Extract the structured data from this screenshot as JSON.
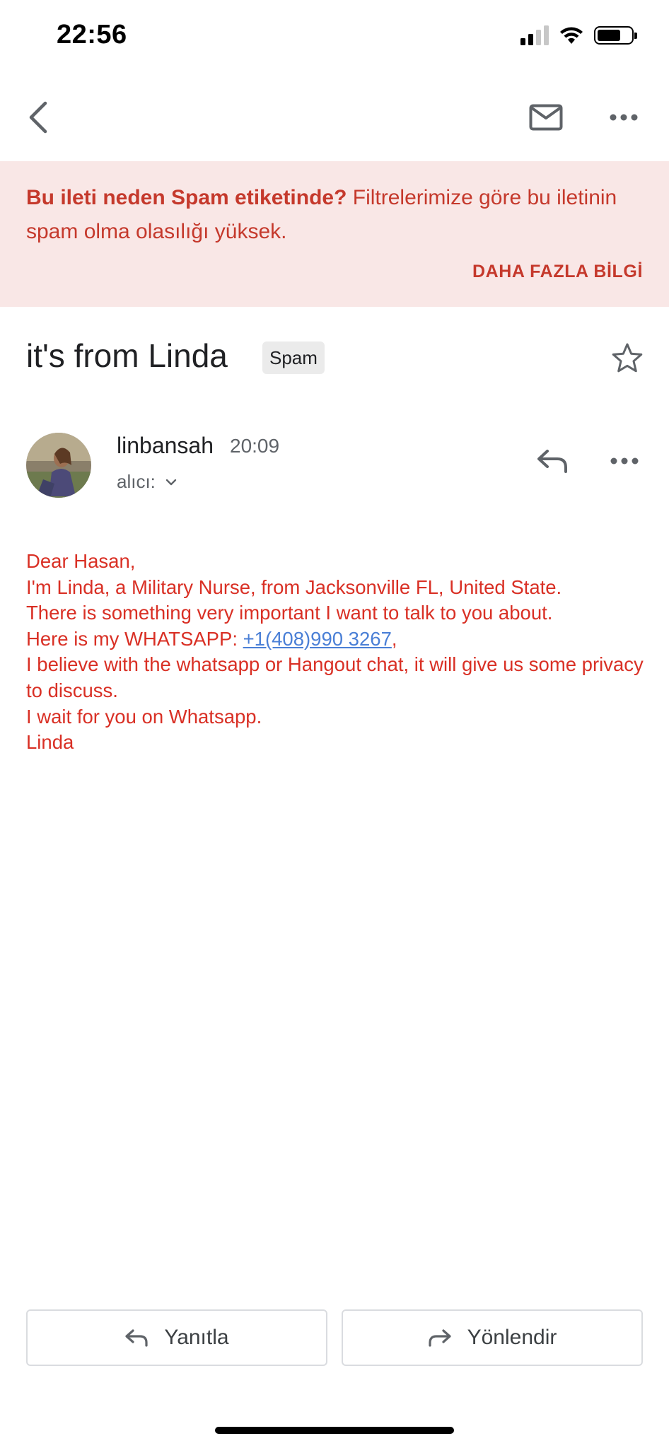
{
  "status_bar": {
    "time": "22:56",
    "icons": [
      "signal-icon",
      "wifi-icon",
      "battery-icon"
    ]
  },
  "top_bar": {
    "icons": [
      "back-arrow-icon",
      "mail-icon",
      "more-horizontal-icon"
    ]
  },
  "spam_banner": {
    "title": "Bu ileti neden Spam etiketinde?",
    "text": " Filtrelerimize göre bu iletinin spam olma olasılığı yüksek.",
    "link": "DAHA FAZLA BİLGİ",
    "bg_color": "#f9e7e6",
    "text_color": "#c5392c"
  },
  "subject": {
    "title": "it's from Linda",
    "badge": "Spam"
  },
  "sender": {
    "name": "linbansah",
    "time": "20:09",
    "recipient_label": "alıcı:"
  },
  "message": {
    "text_color": "#d93025",
    "lines": [
      "Dear Hasan,",
      "I'm Linda, a Military Nurse, from Jacksonville FL, United State.",
      "There is something very important I want to talk to you about.",
      "Here is my WHATSAPP: ",
      "I believe with the whatsapp or Hangout chat, it will give us some privacy to discuss.",
      "I wait for you on Whatsapp.",
      "Linda"
    ],
    "phone": "+1(408)990 3267",
    "phone_suffix": ","
  },
  "actions": {
    "reply_label": "Yanıtla",
    "forward_label": "Yönlendir"
  }
}
